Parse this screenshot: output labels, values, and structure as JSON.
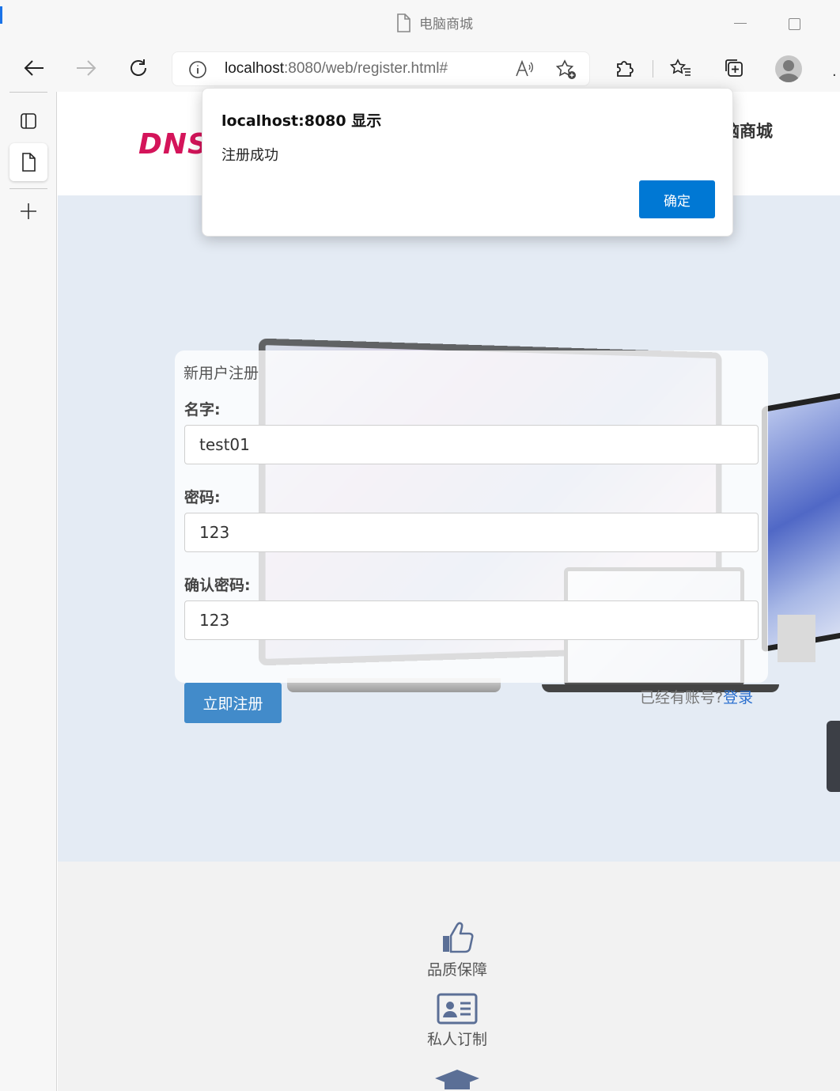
{
  "browser": {
    "tab_title": "电脑商城",
    "address": {
      "host": "localhost",
      "rest": ":8080/web/register.html#"
    }
  },
  "site": {
    "logo_text": "DNS",
    "name_partial": "电脑商城"
  },
  "register": {
    "title": "新用户注册",
    "name_label": "名字:",
    "name_value": "test01",
    "password_label": "密码:",
    "password_value": "123",
    "confirm_label": "确认密码:",
    "confirm_value": "123",
    "submit_label": "立即注册",
    "has_account_text": "已经有账号?",
    "login_link": "登录"
  },
  "footer": {
    "features": [
      {
        "label": "品质保障",
        "icon": "thumbs-up-icon"
      },
      {
        "label": "私人订制",
        "icon": "id-card-icon"
      },
      {
        "label": "",
        "icon": "graduation-cap-icon"
      }
    ]
  },
  "dialog": {
    "title": "localhost:8080 显示",
    "message": "注册成功",
    "ok_label": "确定"
  },
  "colors": {
    "accent": "#0078d4",
    "submit_button": "#428bca",
    "hero_bg": "#e4ebf4",
    "logo": "#d4145a"
  }
}
